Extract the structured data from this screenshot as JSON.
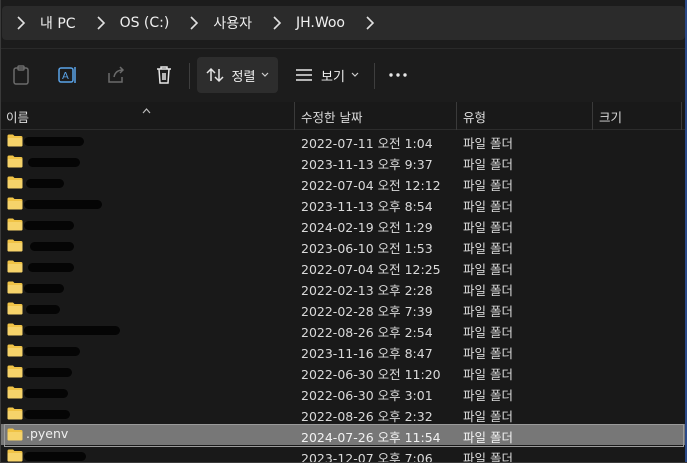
{
  "breadcrumb": {
    "items": [
      {
        "label": "내 PC"
      },
      {
        "label": "OS (C:)"
      },
      {
        "label": "사용자"
      },
      {
        "label": "JH.Woo"
      }
    ]
  },
  "toolbar": {
    "sort_label": "정렬",
    "view_label": "보기"
  },
  "columns": {
    "name": "이름",
    "modified": "수정한 날짜",
    "type": "유형",
    "size": "크기"
  },
  "rows": [
    {
      "name": "",
      "modified": "2022-07-11 오전 1:04",
      "type": "파일 폴더"
    },
    {
      "name": "",
      "modified": "2023-11-13 오후 9:37",
      "type": "파일 폴더"
    },
    {
      "name": "",
      "modified": "2022-07-04 오전 12:12",
      "type": "파일 폴더"
    },
    {
      "name": "",
      "modified": "2023-11-13 오후 8:54",
      "type": "파일 폴더"
    },
    {
      "name": "",
      "modified": "2024-02-19 오전 1:29",
      "type": "파일 폴더"
    },
    {
      "name": "",
      "modified": "2023-06-10 오전 1:53",
      "type": "파일 폴더"
    },
    {
      "name": "",
      "modified": "2022-07-04 오전 12:25",
      "type": "파일 폴더"
    },
    {
      "name": "",
      "modified": "2022-02-13 오후 2:28",
      "type": "파일 폴더"
    },
    {
      "name": "",
      "modified": "2022-02-28 오후 7:39",
      "type": "파일 폴더"
    },
    {
      "name": "",
      "modified": "2022-08-26 오후 2:54",
      "type": "파일 폴더"
    },
    {
      "name": "",
      "modified": "2023-11-16 오후 8:47",
      "type": "파일 폴더"
    },
    {
      "name": "",
      "modified": "2022-06-30 오전 11:20",
      "type": "파일 폴더"
    },
    {
      "name": "",
      "modified": "2022-06-30 오후 3:01",
      "type": "파일 폴더"
    },
    {
      "name": "",
      "modified": "2022-08-26 오후 2:32",
      "type": "파일 폴더"
    },
    {
      "name": ".pyenv",
      "modified": "2024-07-26 오후 11:54",
      "type": "파일 폴더",
      "selected": true
    },
    {
      "name": "",
      "modified": "2023-12-07 오후 7:06",
      "type": "파일 폴더"
    }
  ],
  "colors": {
    "folder": "#f0c346",
    "selected_row": "#777777",
    "background": "#191919"
  }
}
